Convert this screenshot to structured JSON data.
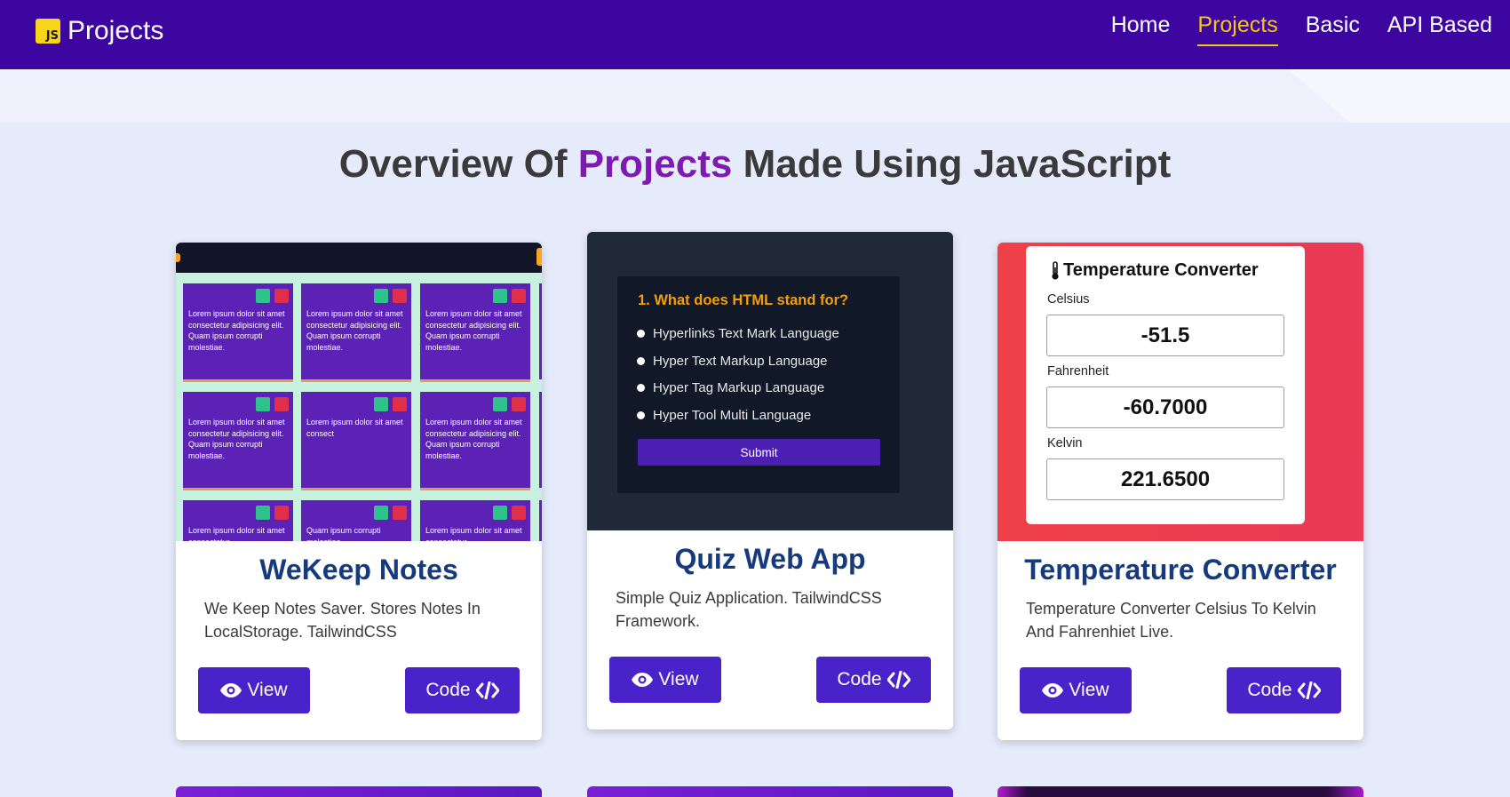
{
  "colors": {
    "navbar": "#3d06a1",
    "active_link": "#f5c518",
    "accent_text": "#7d1aaf",
    "button": "#4a22c9",
    "card_title": "#153a7e"
  },
  "navbar": {
    "logo_text": "JS",
    "brand": "Projects",
    "links": [
      {
        "label": "Home",
        "active": false
      },
      {
        "label": "Projects",
        "active": true
      },
      {
        "label": "Basic",
        "active": false
      },
      {
        "label": "API Based",
        "active": false
      }
    ]
  },
  "heading": {
    "before": "Overview Of",
    "accent": "Projects",
    "after": "Made Using JavaScript"
  },
  "cards": [
    {
      "title": "WeKeep Notes",
      "description": "We Keep Notes Saver. Stores Notes In LocalStorage. TailwindCSS",
      "view_label": "View",
      "code_label": "Code",
      "thumbnail": {
        "notes": [
          "Lorem ipsum dolor sit amet consectetur adipisicing elit. Quam ipsum corrupti molestiae.",
          "Lorem ipsum dolor sit amet consectetur adipisicing elit. Quam ipsum corrupti molestiae.",
          "Lorem ipsum dolor sit amet consectetur adipisicing elit. Quam ipsum corrupti molestiae.",
          "Lorem ipsum dolor sit amet consectetur adipisicing elit. Quam ipsum corrupti molestiae.",
          "Lorem ipsum dolor sit amet consect",
          "Lorem ipsum dolor sit amet consectetur adipisicing elit. Quam ipsum corrupti molestiae.",
          "Lorem ipsum dolor sit amet consectetur",
          "Quam ipsum corrupti molestiae.",
          "Lorem ipsum dolor sit amet consectetur"
        ]
      }
    },
    {
      "title": "Quiz Web App",
      "description": "Simple Quiz Application. TailwindCSS Framework.",
      "view_label": "View",
      "code_label": "Code",
      "thumbnail": {
        "question": "1. What does HTML stand for?",
        "options": [
          "Hyperlinks Text Mark Language",
          "Hyper Text Markup Language",
          "Hyper Tag Markup Language",
          "Hyper Tool Multi Language"
        ],
        "submit": "Submit"
      }
    },
    {
      "title": "Temperature Converter",
      "description": "Temperature Converter Celsius To Kelvin And Fahrenhiet Live.",
      "view_label": "View",
      "code_label": "Code",
      "thumbnail": {
        "title": "Temperature Converter",
        "fields": [
          {
            "label": "Celsius",
            "value": "-51.5"
          },
          {
            "label": "Fahrenheit",
            "value": "-60.7000"
          },
          {
            "label": "Kelvin",
            "value": "221.6500"
          }
        ]
      }
    }
  ]
}
